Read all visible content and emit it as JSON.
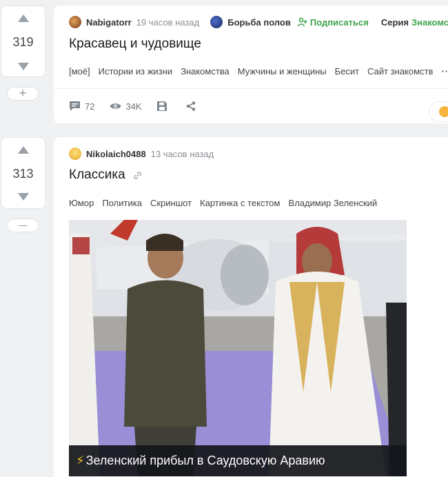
{
  "post1": {
    "votes": "319",
    "author": "Nabigatorr",
    "time": "19 часов назад",
    "community": "Борьба полов",
    "subscribe_label": "Подписаться",
    "series_label": "Серия",
    "series_name": "Знакомства",
    "title": "Красавец и чудовище",
    "tags": [
      "[моё]",
      "Истории из жизни",
      "Знакомства",
      "Мужчины и женщины",
      "Бесит",
      "Сайт знакомств"
    ],
    "more_label": "···",
    "comments": "72",
    "views": "34K",
    "add_button": "+"
  },
  "post2": {
    "votes": "313",
    "author": "Nikolaich0488",
    "time": "13 часов назад",
    "title": "Классика",
    "tags": [
      "Юмор",
      "Политика",
      "Скриншот",
      "Картинка с текстом",
      "Владимир Зеленский"
    ],
    "image_caption": "Зеленский прибыл в Саудовскую Аравию",
    "caption_icon": "⚡",
    "minus_button": "—"
  },
  "icons": {
    "vote_up": "triangle-up",
    "vote_down": "triangle-down",
    "comments": "speech-bubble",
    "views": "eye",
    "save": "floppy-disk",
    "share": "share-nodes",
    "link": "chain-link",
    "subscribe": "person-plus"
  },
  "colors": {
    "accent_green": "#3fa34d",
    "background": "#f0f1f2",
    "caption_bg": "#14161a"
  }
}
